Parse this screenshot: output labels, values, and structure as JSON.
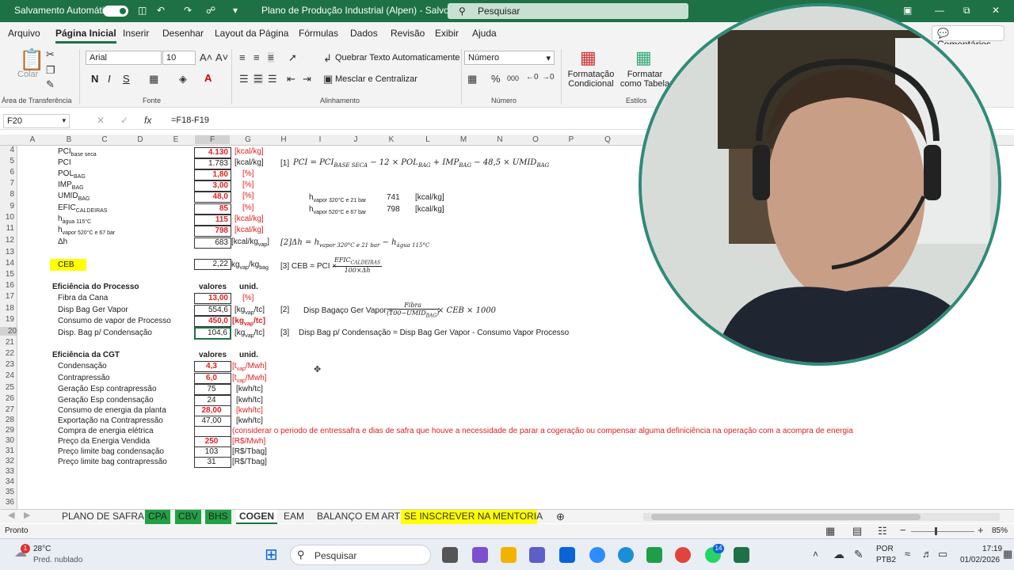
{
  "titlebar": {
    "autosave": "Salvamento Automático",
    "title": "Plano de Produção Industrial (Alpen)  -  Salvo",
    "search": "Pesquisar"
  },
  "menu": {
    "tabs": [
      "Arquivo",
      "Página Inicial",
      "Inserir",
      "Desenhar",
      "Layout da Página",
      "Fórmulas",
      "Dados",
      "Revisão",
      "Exibir",
      "Ajuda"
    ],
    "comments": "Comentários"
  },
  "ribbon": {
    "font": "Arial",
    "size": "10",
    "wrap": "Quebrar Texto Automaticamente",
    "merge": "Mesclar e Centralizar",
    "numfmt": "Número",
    "cond": "Formatação Condicional",
    "table": "Formatar como Tabela",
    "paste": "Colar",
    "groups": {
      "clip": "Área de Transferência",
      "font": "Fonte",
      "align": "Alinhamento",
      "num": "Número",
      "styles": "Estilos"
    },
    "bold": "N",
    "italic": "I",
    "under": "S"
  },
  "formula": {
    "name": "F20",
    "fx": "fx",
    "text": "=F18-F19"
  },
  "columns": [
    "A",
    "B",
    "C",
    "D",
    "E",
    "F",
    "G",
    "H",
    "I",
    "J",
    "K",
    "L",
    "M",
    "N",
    "O",
    "P",
    "Q"
  ],
  "rows": [
    "4",
    "5",
    "6",
    "7",
    "8",
    "9",
    "10",
    "11",
    "12",
    "13",
    "14",
    "15",
    "16",
    "17",
    "18",
    "19",
    "20",
    "21",
    "22",
    "23",
    "24",
    "25",
    "26",
    "27",
    "28",
    "29",
    "30",
    "31",
    "32",
    "33",
    "34",
    "35",
    "36"
  ],
  "cells": {
    "r4": {
      "label": "PCI",
      "sub": "base seca",
      "val": "4.130",
      "unit": "[kcal/kg]"
    },
    "r5": {
      "label": "PCI",
      "val": "1.783",
      "unit": "[kcal/kg]"
    },
    "r6": {
      "label": "POL",
      "sub": "BAG",
      "val": "1,80",
      "unit": "[%]"
    },
    "r7": {
      "label": "IMP",
      "sub": "BAG",
      "val": "3,00",
      "unit": "[%]"
    },
    "r8": {
      "label": "UMID",
      "sub": "BAG",
      "val": "48,0",
      "unit": "[%]"
    },
    "r9": {
      "label": "EFIC",
      "sub": "CALDEIRAS",
      "val": "85",
      "unit": "[%]"
    },
    "r10": {
      "label": "h",
      "sub": "água 115°C",
      "val": "115",
      "unit": "[kcal/kg]"
    },
    "r11": {
      "label": "h",
      "sub": "vapor 520°C e 67 bar",
      "val": "798",
      "unit": "[kcal/kg]"
    },
    "r12": {
      "label": "Δh",
      "val": "683",
      "unit": "[kcal/kg",
      "unitsub": "vap",
      "unitend": "]"
    },
    "r14": {
      "label": "CEB",
      "val": "2,22",
      "unit": "kg",
      "unitsub": "vap",
      "unitmid": "/kg",
      "unitsub2": "bag"
    },
    "proc": {
      "title": "Eficiência do Processo",
      "valores": "valores",
      "unid": "unid."
    },
    "r17": {
      "label": "Fibra da Cana",
      "val": "13,00",
      "unit": "[%]"
    },
    "r18": {
      "label": "Disp Bag Ger Vapor",
      "val": "554,6",
      "unit": "[kg",
      "unitsub": "vap",
      "unitend": "/tc]"
    },
    "r19": {
      "label": "Consumo de vapor de Processo",
      "val": "450,0",
      "unit": "[kg",
      "unitsub": "vap",
      "unitend": "/tc]"
    },
    "r20": {
      "label": "Disp. Bag p/ Condensação",
      "val": "104,6",
      "unit": "[kg",
      "unitsub": "vap",
      "unitend": "/tc]"
    },
    "cgt": {
      "title": "Eficiência da CGT",
      "valores": "valores",
      "unid": "unid."
    },
    "r23": {
      "label": "Condensação",
      "val": "4,3",
      "unit": "[t",
      "unitsub": "vap",
      "unitend": "/Mwh]"
    },
    "r24": {
      "label": "Contrapressão",
      "val": "6,0",
      "unit": "[t",
      "unitsub": "vap",
      "unitend": "/Mwh]"
    },
    "r25": {
      "label": "Geração Esp contrapressão",
      "val": "75",
      "unit": "[kwh/tc]"
    },
    "r26": {
      "label": "Geração Esp condensação",
      "val": "24",
      "unit": "[kwh/tc]"
    },
    "r27": {
      "label": "Consumo de energia da planta",
      "val": "28,00",
      "unit": "[kwh/tc]"
    },
    "r28": {
      "label": "Exportação na Contrapressão",
      "val": "47,00",
      "unit": "[kwh/tc]"
    },
    "r29": {
      "label": "Compra de energia elétrica",
      "note": "(considerar o periodo de entressafra e dias de safra que houve a necessidade de parar a cogeração ou compensar alguma definiciência na operação com a acompra de energia"
    },
    "r30": {
      "label": "Preço da Energia Vendida",
      "val": "250",
      "unit": "[R$/Mwh]"
    },
    "r31": {
      "label": "Preço limite bag condensação",
      "val": "103",
      "unit": "[R$/Tbag]"
    },
    "r32": {
      "label": "Preço limite bag contrapressão",
      "val": "31",
      "unit": "[R$/Tbag]"
    }
  },
  "notes": {
    "n1": "[1]",
    "n2": "[2]",
    "n3": "[3]",
    "h1label": "h",
    "h1sub": "vapor 320°C e 21 bar",
    "h1val": "741",
    "h1unit": "[kcal/kg]",
    "h2label": "h",
    "h2sub": "vapor 520°C e 67 bar",
    "h2val": "798",
    "h2unit": "[kcal/kg]",
    "ceb": "[3] CEB = PCI ×",
    "dispgen": "Disp Bagaço Ger Vapor =",
    "fibra": "Fibra",
    "fibraden": "(100−UMID",
    "fibraden_sub": "BAG",
    "fibraden_end": ")",
    "times": "× CEB × 1000",
    "dispcond": "Disp Bag p/ Condensação = Disp Bag Ger Vapor - Consumo Vapor Processo",
    "eficnum": "EFIC",
    "eficsub": "CALDEIRAS",
    "eficden": "100×Δh"
  },
  "sheets": [
    "PLANO DE SAFRA",
    "CPA",
    "CBV",
    "BHS",
    "COGEN",
    "EAM",
    "BALANÇO EM ART",
    "SE INSCREVER NA MENTORIA"
  ],
  "status": {
    "ready": "Pronto",
    "zoom": "85%"
  },
  "taskbar": {
    "temp": "28°C",
    "weather": "Pred. nublado",
    "search": "Pesquisar",
    "lang1": "POR",
    "lang2": "PTB2",
    "time": "17:19",
    "date": "01/02/2026",
    "badge": "14",
    "wbadge": "1"
  }
}
